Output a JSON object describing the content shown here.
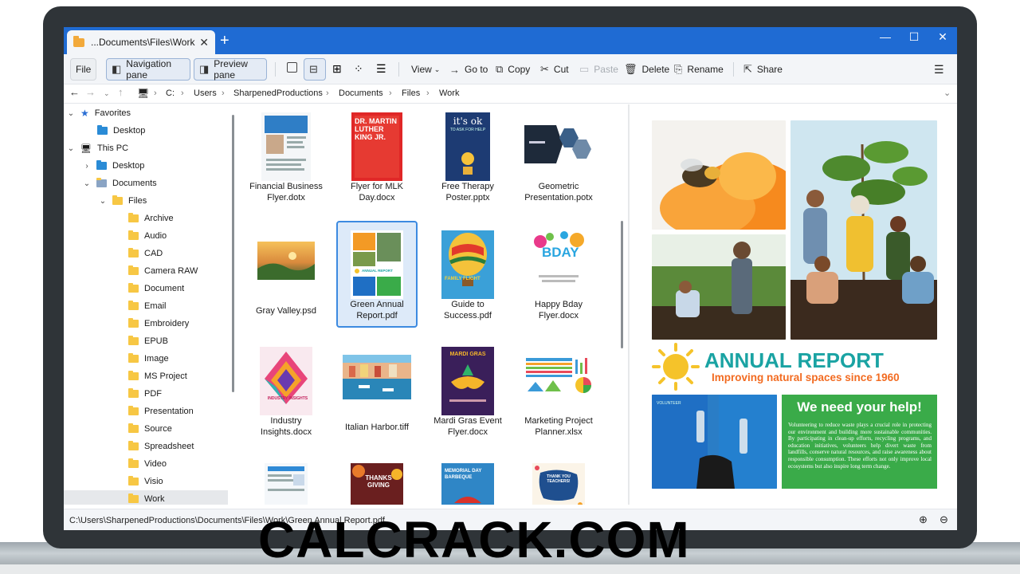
{
  "window": {
    "tab_title": "...Documents\\Files\\Work",
    "tab_close": "✕",
    "new_tab": "+",
    "minimize": "—",
    "maximize": "☐",
    "close": "✕"
  },
  "toolbar": {
    "file": "File",
    "navigation_pane": "Navigation pane",
    "preview_pane": "Preview pane",
    "view": "View",
    "go_to": "Go to",
    "copy": "Copy",
    "cut": "Cut",
    "paste": "Paste",
    "delete": "Delete",
    "rename": "Rename",
    "share": "Share",
    "menu": "☰"
  },
  "address": {
    "crumbs": [
      "C:",
      "Users",
      "SharpenedProductions",
      "Documents",
      "Files",
      "Work"
    ]
  },
  "sidebar": {
    "favorites": "Favorites",
    "desktop_fav": "Desktop",
    "this_pc": "This PC",
    "desktop": "Desktop",
    "documents": "Documents",
    "files": "Files",
    "folders": [
      "Archive",
      "Audio",
      "CAD",
      "Camera RAW",
      "Document",
      "Email",
      "Embroidery",
      "EPUB",
      "Image",
      "MS Project",
      "PDF",
      "Presentation",
      "Source",
      "Spreadsheet",
      "Video",
      "Visio",
      "Work"
    ]
  },
  "files": [
    {
      "line1": "Financial Business",
      "line2": "Flyer.dotx"
    },
    {
      "line1": "Flyer for MLK",
      "line2": "Day.docx"
    },
    {
      "line1": "Free Therapy",
      "line2": "Poster.pptx"
    },
    {
      "line1": "Geometric",
      "line2": "Presentation.potx"
    },
    {
      "line1": "Gray Valley.psd",
      "line2": ""
    },
    {
      "line1": "Green Annual",
      "line2": "Report.pdf"
    },
    {
      "line1": "Guide to",
      "line2": "Success.pdf"
    },
    {
      "line1": "Happy Bday",
      "line2": "Flyer.docx"
    },
    {
      "line1": "Industry",
      "line2": "Insights.docx"
    },
    {
      "line1": "Italian Harbor.tiff",
      "line2": ""
    },
    {
      "line1": "Mardi Gras Event",
      "line2": "Flyer.docx"
    },
    {
      "line1": "Marketing Project",
      "line2": "Planner.xlsx"
    }
  ],
  "thumb_text": {
    "mlk": "DR. MARTIN LUTHER KING JR.",
    "therapy": "it's ok",
    "therapy_sub": "TO ASK FOR HELP",
    "bday": "BDAY",
    "industry": "INDUSTRY INSIGHTS",
    "mardi": "MARDI GRAS",
    "memorial": "MEMORIAL DAY BARBEQUE",
    "thanks": "THANKS GIVING",
    "teachers": "THANK YOU TEACHERS!",
    "guide": "FAMILY FLIGHT",
    "green_report": "ANNUAL REPORT"
  },
  "preview": {
    "report_title": "ANNUAL REPORT",
    "report_subtitle": "Improving natural spaces since 1960",
    "help_title": "We need your help!",
    "help_body": "Volunteering to reduce waste plays a crucial role in protecting our environment and building more sustainable communities. By participating in clean-up efforts, recycling programs, and education initiatives, volunteers help divert waste from landfills, conserve natural resources, and raise awareness about responsible consumption. These efforts not only improve local ecosystems but also inspire long term change.",
    "shirt_label": "VOLUNTEER"
  },
  "status": {
    "path": "C:\\Users\\SharpenedProductions\\Documents\\Files\\Work\\Green Annual Report.pdf"
  },
  "watermark": "CALCRACK.COM",
  "colors": {
    "accent": "#1f6bd3",
    "selection": "#3c8ae0",
    "report_teal": "#1aa3a3",
    "report_orange": "#f26b21",
    "help_green": "#3aab49"
  }
}
